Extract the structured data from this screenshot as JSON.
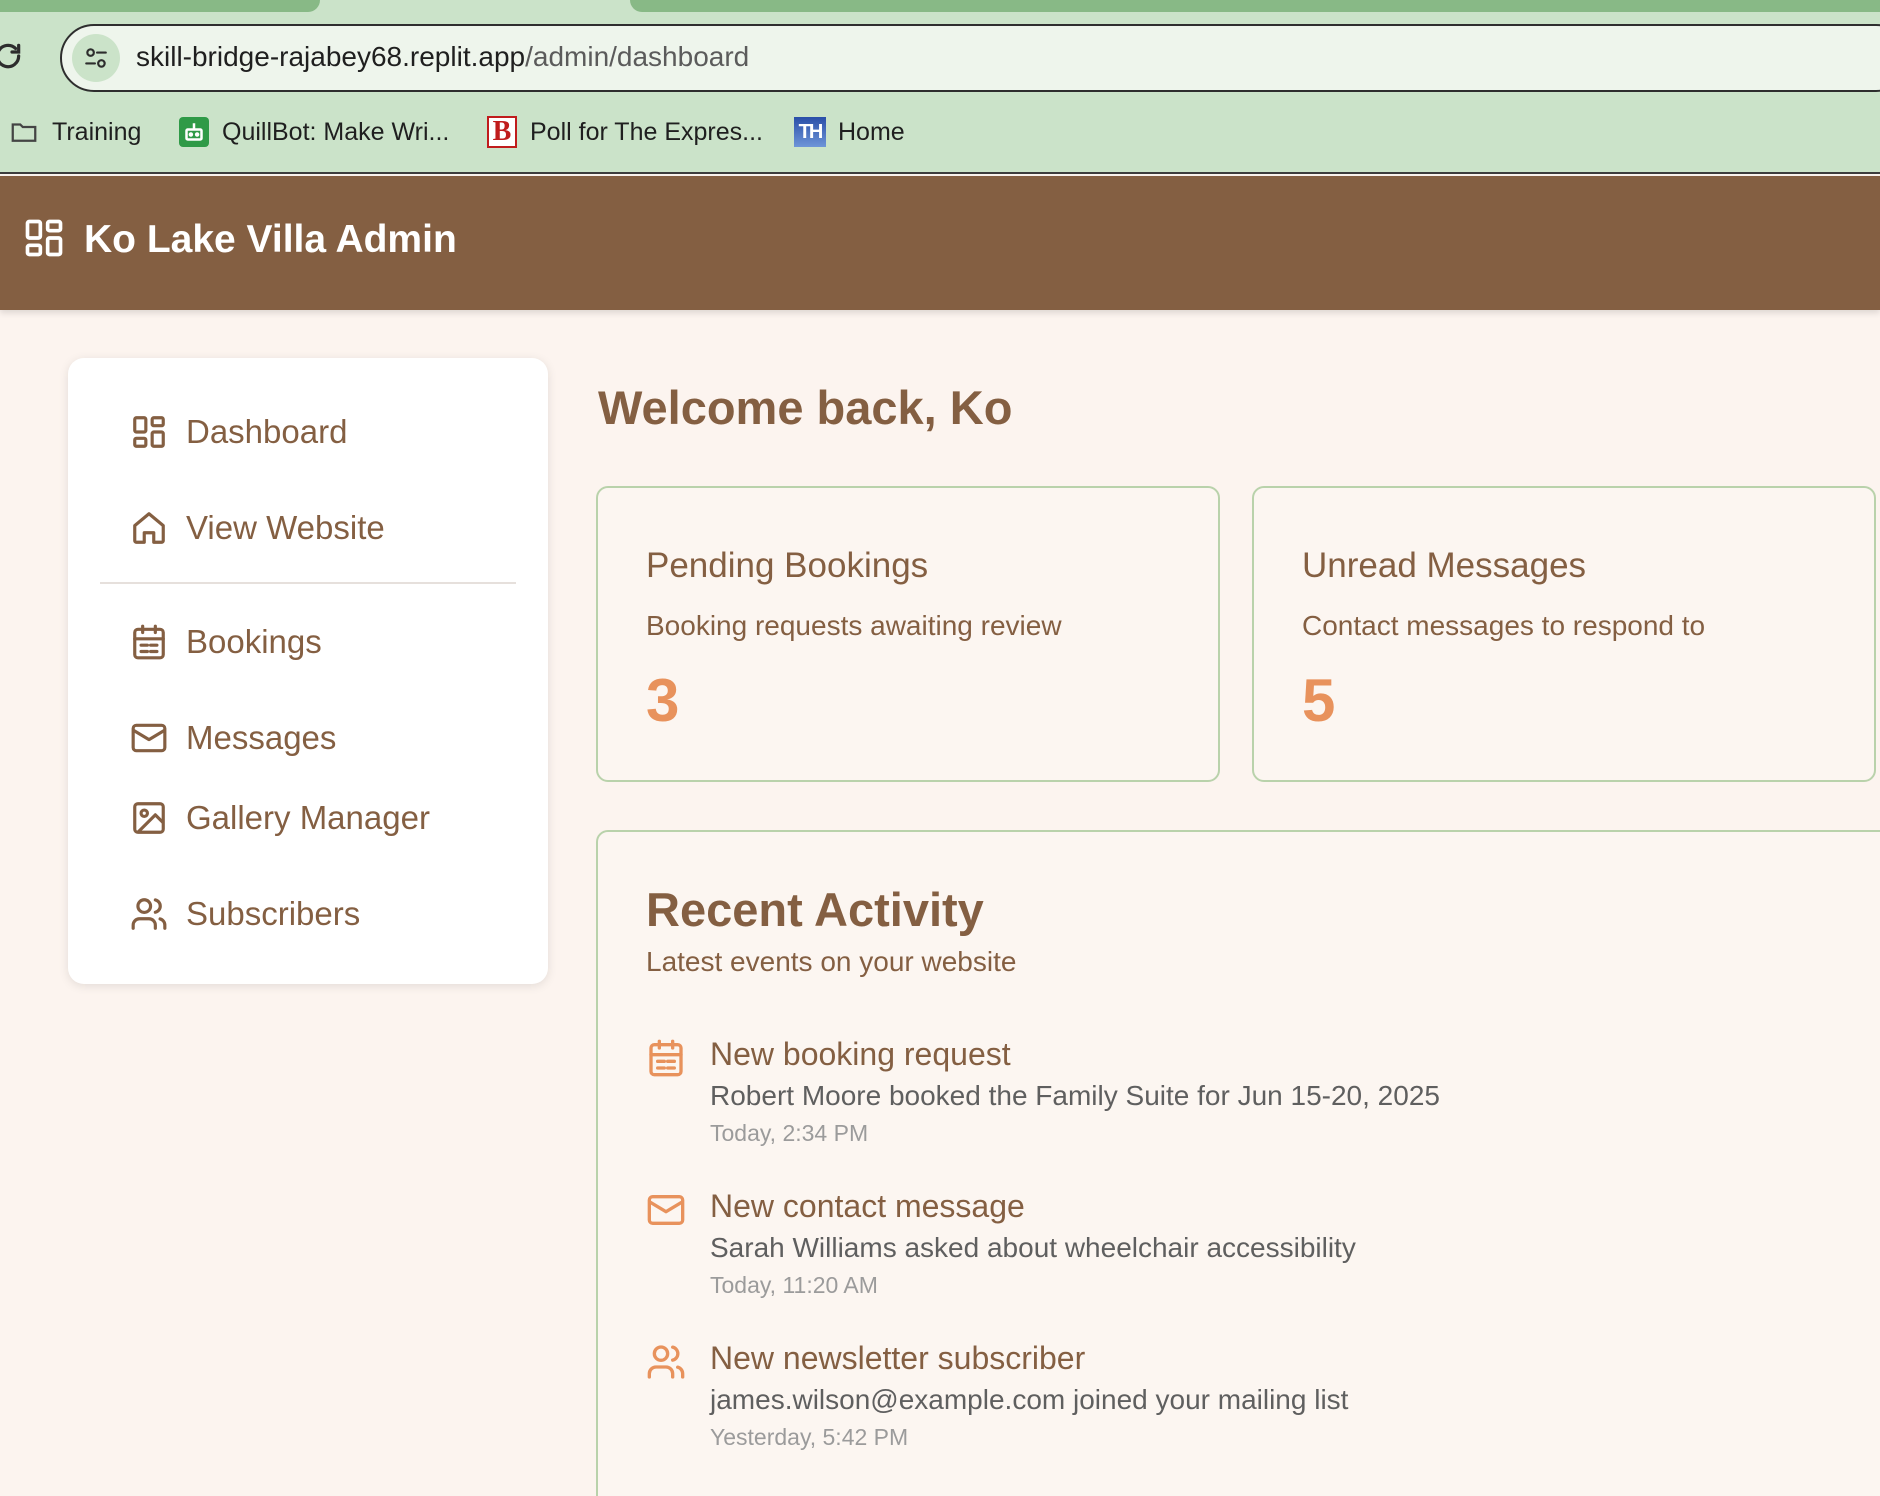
{
  "browser": {
    "url_host": "skill-bridge-rajabey68.replit.app",
    "url_path": "/admin/dashboard",
    "bookmarks": [
      {
        "label": "Training",
        "icon": "folder-icon"
      },
      {
        "label": "QuillBot: Make Wri...",
        "icon": "quillbot-icon"
      },
      {
        "label": "Poll for The Expres...",
        "icon": "b-logo-icon"
      },
      {
        "label": "Home",
        "icon": "th-logo-icon"
      }
    ],
    "bookmark_logo_text": {
      "b": "B",
      "th": "TH"
    }
  },
  "header": {
    "title": "Ko Lake Villa Admin",
    "icon": "dashboard-grid-icon",
    "color": "#845f42"
  },
  "sidebar": {
    "items": [
      {
        "label": "Dashboard",
        "icon": "dashboard-grid-icon"
      },
      {
        "label": "View Website",
        "icon": "home-icon"
      },
      {
        "label": "Bookings",
        "icon": "calendar-icon"
      },
      {
        "label": "Messages",
        "icon": "mail-icon"
      },
      {
        "label": "Gallery Manager",
        "icon": "image-icon"
      },
      {
        "label": "Subscribers",
        "icon": "users-icon"
      }
    ]
  },
  "main": {
    "welcome": "Welcome back, Ko",
    "stats": [
      {
        "title": "Pending Bookings",
        "description": "Booking requests awaiting review",
        "value": "3"
      },
      {
        "title": "Unread Messages",
        "description": "Contact messages to respond to",
        "value": "5"
      }
    ],
    "activity": {
      "title": "Recent Activity",
      "subtitle": "Latest events on your website",
      "items": [
        {
          "title": "New booking request",
          "description": "Robert Moore booked the Family Suite for Jun 15-20, 2025",
          "time": "Today, 2:34 PM",
          "icon": "calendar-icon"
        },
        {
          "title": "New contact message",
          "description": "Sarah Williams asked about wheelchair accessibility",
          "time": "Today, 11:20 AM",
          "icon": "mail-icon"
        },
        {
          "title": "New newsletter subscriber",
          "description": "james.wilson@example.com joined your mailing list",
          "time": "Yesterday, 5:42 PM",
          "icon": "users-icon"
        }
      ]
    }
  },
  "colors": {
    "brand_brown": "#845f42",
    "accent_orange": "#e8925c",
    "card_border": "#b9d2ab",
    "page_background": "#fcf4ef"
  }
}
